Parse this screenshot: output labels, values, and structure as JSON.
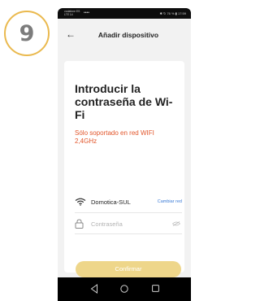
{
  "step": {
    "number": "9"
  },
  "status_bar": {
    "carrier_line1": "vodafone ES",
    "carrier_line2": "LTE 14",
    "signal_text": "••••",
    "right_text": "✱ ↻ 76 % ▮ 17:59"
  },
  "app_bar": {
    "back_icon": "←",
    "title": "Añadir dispositivo"
  },
  "card": {
    "title": "Introducir la contraseña de Wi-Fi",
    "note": "Sólo soportado en red WIFI 2,4GHz",
    "wifi_name": "Domotica-SUL",
    "change_network_label": "Cambiar red",
    "password_placeholder": "Contraseña",
    "confirm_label": "Confirmar"
  },
  "icons": {
    "back": "back-arrow-icon",
    "wifi": "wifi-icon",
    "lock": "lock-icon",
    "eye": "eye-icon",
    "nav_back": "nav-back-icon",
    "nav_home": "nav-home-icon",
    "nav_recent": "nav-recent-icon"
  },
  "colors": {
    "badge_border": "#eab94e",
    "note_text": "#e2552a",
    "link": "#3b7bd6",
    "confirm_button": "#eed68a"
  }
}
